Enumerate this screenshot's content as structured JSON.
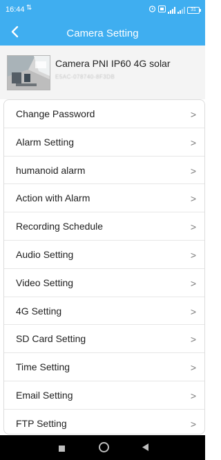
{
  "status": {
    "time": "16:44",
    "battery": "31"
  },
  "colors": {
    "header": "#3faef0",
    "panel": "#f4f4f4"
  },
  "nav": {
    "title": "Camera Setting",
    "back_icon": "chevron-left-icon"
  },
  "camera": {
    "name": "Camera PNI IP60 4G solar",
    "uid": "E5AC-078740-8F3DB"
  },
  "settings": {
    "items": [
      {
        "label": "Change Password"
      },
      {
        "label": "Alarm Setting"
      },
      {
        "label": "humanoid alarm"
      },
      {
        "label": "Action with Alarm"
      },
      {
        "label": "Recording Schedule"
      },
      {
        "label": "Audio Setting"
      },
      {
        "label": "Video Setting"
      },
      {
        "label": "4G Setting"
      },
      {
        "label": "SD Card Setting"
      },
      {
        "label": "Time Setting"
      },
      {
        "label": "Email Setting"
      },
      {
        "label": "FTP Setting"
      }
    ],
    "chevron": ">"
  },
  "system_nav": {
    "icons": [
      "recents-square-icon",
      "home-circle-icon",
      "back-triangle-icon"
    ]
  }
}
